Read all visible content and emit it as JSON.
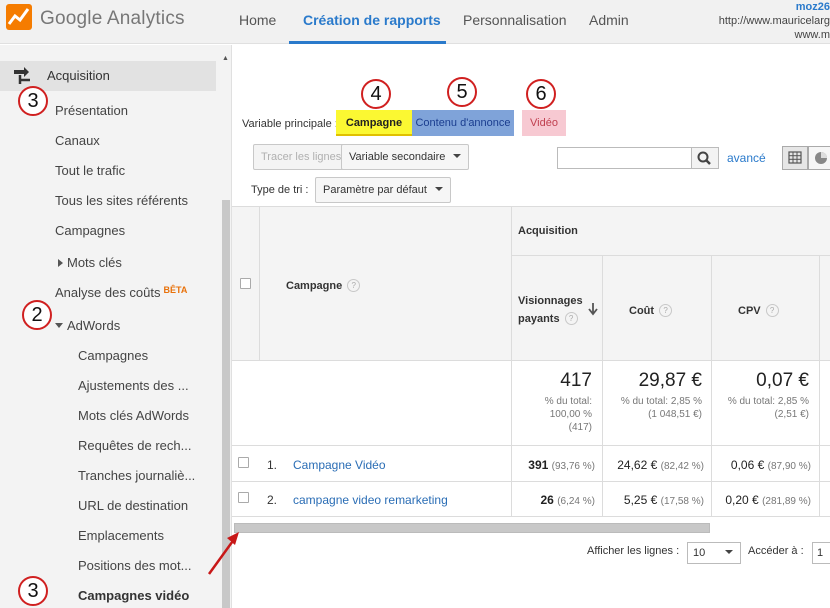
{
  "topbar": {
    "brand": "Google Analytics",
    "nav": [
      "Home",
      "Création de rapports",
      "Personnalisation",
      "Admin"
    ],
    "account_user": "moz26",
    "account_url1": "http://www.mauricelarg",
    "account_url2": "www.m"
  },
  "sidebar": {
    "section": "Acquisition",
    "items": [
      "Présentation",
      "Canaux",
      "Tout le trafic",
      "Tous les sites référents",
      "Campagnes",
      "Mots clés",
      "Analyse des coûts",
      "AdWords"
    ],
    "beta": "BÊTA",
    "adwords_items": [
      "Campagnes",
      "Ajustements des ...",
      "Mots clés AdWords",
      "Requêtes de rech...",
      "Tranches journaliè...",
      "URL de destination",
      "Emplacements",
      "Positions des mot...",
      "Campagnes vidéo"
    ]
  },
  "annotations": [
    "3",
    "2",
    "3",
    "4",
    "5",
    "6"
  ],
  "toolbar": {
    "primary_dimension_label": "Variable principale :",
    "dimension_tabs": [
      "Campagne",
      "Contenu d'annonce",
      "Vidéo"
    ],
    "plot_rows": "Tracer les lignes",
    "secondary_dimension": "Variable secondaire",
    "search_placeholder": "",
    "advanced": "avancé",
    "sort_label": "Type de tri :",
    "sort_value": "Paramètre par défaut"
  },
  "table": {
    "group_header": "Acquisition",
    "dimension_header": "Campagne",
    "columns": [
      "Visionnages payants",
      "Coût",
      "CPV"
    ],
    "totals": {
      "views": "417",
      "views_pct": "% du total:",
      "views_pct2": "100,00 %",
      "views_abs": "(417)",
      "cost": "29,87 €",
      "cost_pct": "% du total: 2,85 %",
      "cost_abs": "(1 048,51 €)",
      "cpv": "0,07 €",
      "cpv_pct": "% du total: 2,85 %",
      "cpv_abs": "(2,51 €)"
    },
    "rows": [
      {
        "num": "1.",
        "name": "Campagne Vidéo",
        "views": "391",
        "views_pct": "(93,76 %)",
        "cost": "24,62 €",
        "cost_pct": "(82,42 %)",
        "cpv": "0,06 €",
        "cpv_pct": "(87,90 %)"
      },
      {
        "num": "2.",
        "name": "campagne video remarketing",
        "views": "26",
        "views_pct": "(6,24 %)",
        "cost": "5,25 €",
        "cost_pct": "(17,58 %)",
        "cpv": "0,20 €",
        "cpv_pct": "(281,89 %)"
      }
    ]
  },
  "footer": {
    "rows_label": "Afficher les lignes :",
    "rows_value": "10",
    "goto_label": "Accéder à :",
    "goto_value": "1"
  },
  "colors": {
    "accent": "#2a7acb",
    "tab_campagne": "#fbf832",
    "tab_contenu": "#7fa3d9",
    "tab_video": "#f7c9d2",
    "annotation_circle": "#d02020",
    "beta": "#e8710a"
  }
}
